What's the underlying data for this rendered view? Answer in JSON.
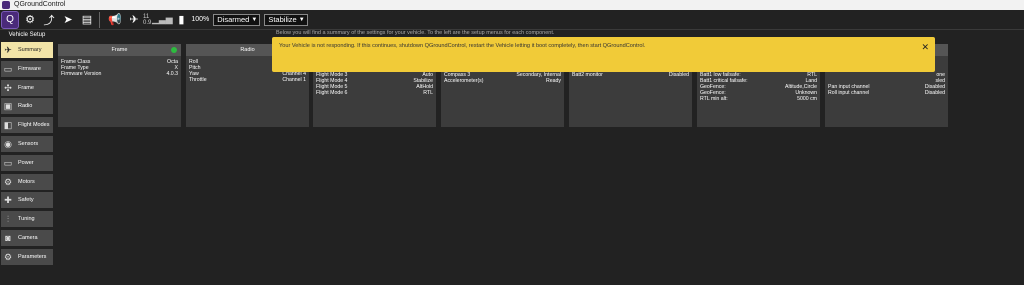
{
  "window": {
    "title": "QGroundControl"
  },
  "toolbar": {
    "satellite_count": "11",
    "hdop": "0.9",
    "battery": "100%",
    "arm_state": "Disarmed",
    "flight_mode": "Stabilize"
  },
  "sidebar": {
    "header": "Vehicle Setup",
    "items": [
      {
        "label": "Summary",
        "icon": "plane-icon"
      },
      {
        "label": "Firmware",
        "icon": "firmware-icon"
      },
      {
        "label": "Frame",
        "icon": "frame-icon"
      },
      {
        "label": "Radio",
        "icon": "radio-icon"
      },
      {
        "label": "Flight Modes",
        "icon": "flight-modes-icon"
      },
      {
        "label": "Sensors",
        "icon": "sensors-icon"
      },
      {
        "label": "Power",
        "icon": "power-icon"
      },
      {
        "label": "Motors",
        "icon": "motors-icon"
      },
      {
        "label": "Safety",
        "icon": "safety-icon"
      },
      {
        "label": "Tuning",
        "icon": "tuning-icon"
      },
      {
        "label": "Camera",
        "icon": "camera-icon"
      },
      {
        "label": "Parameters",
        "icon": "parameters-icon"
      }
    ]
  },
  "main": {
    "hint": "Below you will find a summary of the settings for your vehicle. To the left are the setup menus for each component."
  },
  "banner": {
    "message": "Your Vehicle is not responding. If this continues, shutdown QGroundControl, restart the Vehicle letting it boot completely, then start QGroundControl."
  },
  "panels": [
    {
      "title": "Frame",
      "rows": [
        {
          "k": "Frame Class",
          "v": "Octa"
        },
        {
          "k": "Frame Type",
          "v": "X"
        },
        {
          "k": "Firmware Version",
          "v": "4.0.3"
        }
      ]
    },
    {
      "title": "Radio",
      "rows": [
        {
          "k": "Roll",
          "v": ""
        },
        {
          "k": "Pitch",
          "v": ""
        },
        {
          "k": "Yaw",
          "v": "Channel 4"
        },
        {
          "k": "Throttle",
          "v": "Channel 1"
        }
      ]
    },
    {
      "title": "",
      "rows": [
        {
          "k": "Flight Mode 3",
          "v": "Auto"
        },
        {
          "k": "Flight Mode 4",
          "v": "Stabilize"
        },
        {
          "k": "Flight Mode 5",
          "v": "AltHold"
        },
        {
          "k": "Flight Mode 6",
          "v": "RTL"
        }
      ]
    },
    {
      "title": "",
      "rows": [
        {
          "k": "Compass 3",
          "v": "Secondary, Internal"
        },
        {
          "k": "Accelerometer(s)",
          "v": "Ready"
        }
      ]
    },
    {
      "title": "",
      "rows": [
        {
          "k": "Batt2 monitor",
          "v": "Disabled"
        }
      ]
    },
    {
      "title": "",
      "rows": [
        {
          "k": "Batt1 low failsafe:",
          "v": "RTL"
        },
        {
          "k": "Batt1 critical failsafe:",
          "v": "Land"
        },
        {
          "k": "GeoFence:",
          "v": "Altitude,Circle"
        },
        {
          "k": "GeoFence:",
          "v": "Unknown"
        },
        {
          "k": "RTL min alt:",
          "v": "5000 cm"
        }
      ]
    },
    {
      "title": "",
      "rows": [
        {
          "k": "",
          "v": "one"
        },
        {
          "k": "",
          "v": "sled"
        },
        {
          "k": "Pan input channel",
          "v": "Disabled"
        },
        {
          "k": "Roll input channel",
          "v": "Disabled"
        }
      ]
    }
  ]
}
